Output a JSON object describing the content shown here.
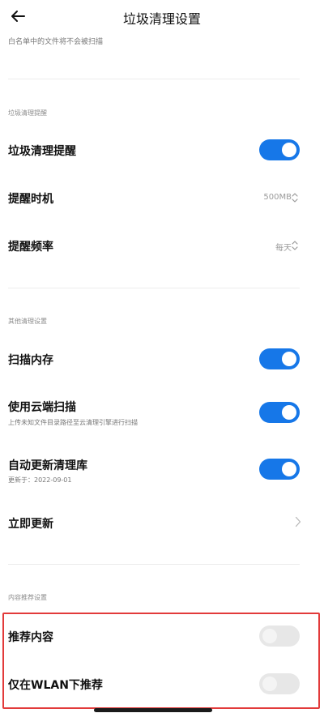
{
  "header": {
    "title": "垃圾清理设置"
  },
  "top": {
    "subtitle_clipped": "白名单中的文件将不会被扫描"
  },
  "sections": {
    "junk_reminder": {
      "label": "垃圾清理提醒",
      "rows": {
        "reminder": {
          "label": "垃圾清理提醒",
          "toggle": "on"
        },
        "timing": {
          "label": "提醒时机",
          "value": "500MB"
        },
        "frequency": {
          "label": "提醒频率",
          "value": "每天"
        }
      }
    },
    "other_settings": {
      "label": "其他清理设置",
      "rows": {
        "scan_memory": {
          "label": "扫描内存",
          "toggle": "on"
        },
        "cloud_scan": {
          "label": "使用云端扫描",
          "sub": "上传未知文件目录路径至云清理引擎进行扫描",
          "toggle": "on"
        },
        "auto_update": {
          "label": "自动更新清理库",
          "sub": "更新于：2022-09-01",
          "toggle": "on"
        },
        "update_now": {
          "label": "立即更新"
        }
      }
    },
    "content_recommend": {
      "label": "内容推荐设置",
      "rows": {
        "recommend": {
          "label": "推荐内容",
          "toggle": "off"
        },
        "wlan_only": {
          "label": "仅在WLAN下推荐",
          "toggle": "off"
        }
      }
    }
  },
  "colors": {
    "toggle_on": "#1677e8",
    "toggle_off": "#e7e7e7",
    "highlight": "#e23a3a"
  }
}
